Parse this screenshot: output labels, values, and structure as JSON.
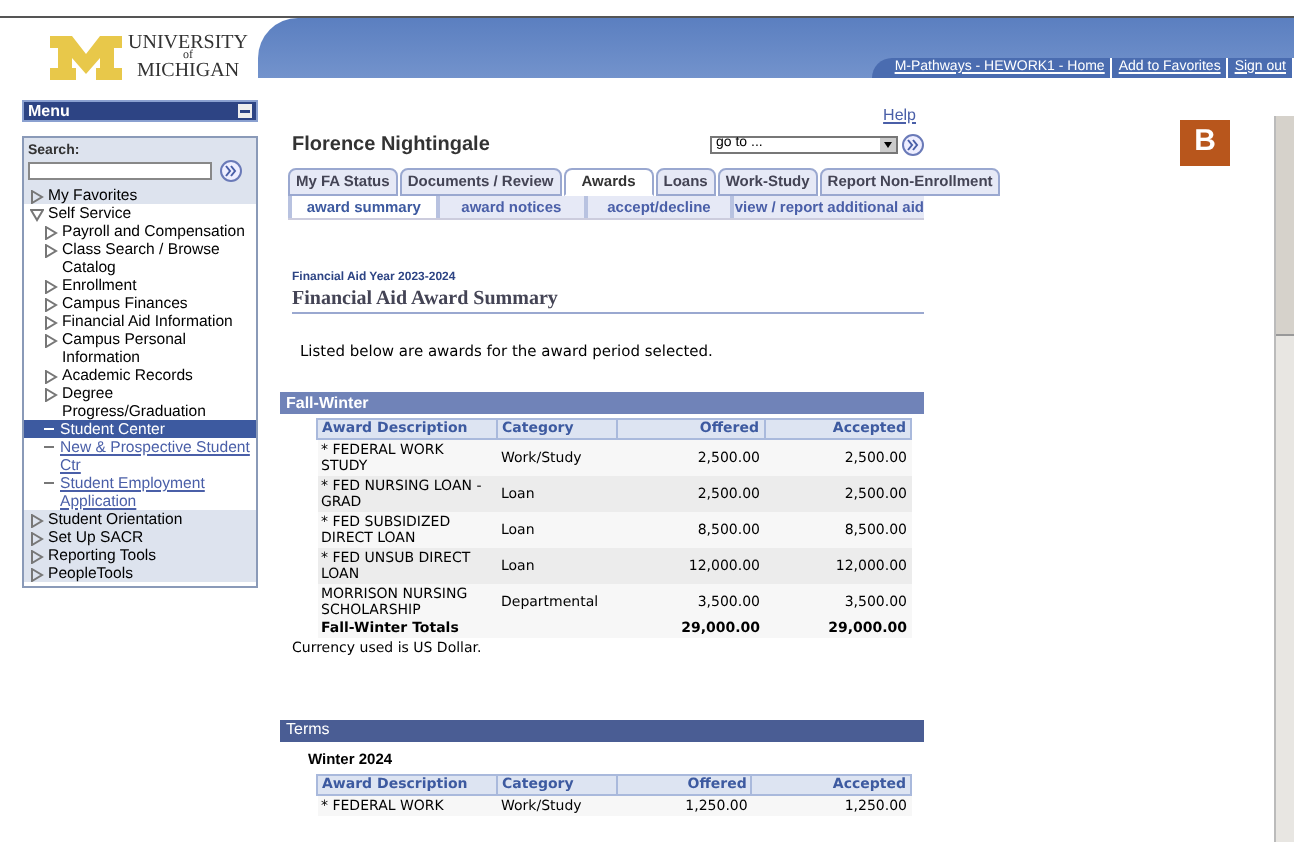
{
  "logo": {
    "line_1": "UNIVERSITY",
    "line_2": "of",
    "line_3": "MICHIGAN"
  },
  "header_links": [
    "M-Pathways - HEWORK1 - Home",
    "Add to Favorites",
    "Sign out"
  ],
  "menu": {
    "title": "Menu",
    "search_label": "Search:",
    "items": [
      {
        "label": "My Favorites",
        "kind": "folder",
        "expanded": false,
        "selected": false
      },
      {
        "label": "Self Service",
        "kind": "folder",
        "expanded": true,
        "selected": false,
        "children": [
          {
            "label": "Payroll and Compensation",
            "kind": "folder",
            "expanded": false,
            "selected": false
          },
          {
            "label": "Class Search / Browse Catalog",
            "kind": "folder",
            "expanded": false,
            "selected": false
          },
          {
            "label": "Enrollment",
            "kind": "folder",
            "expanded": false,
            "selected": false
          },
          {
            "label": "Campus Finances",
            "kind": "folder",
            "expanded": false,
            "selected": false
          },
          {
            "label": "Financial Aid Information",
            "kind": "folder",
            "expanded": false,
            "selected": false
          },
          {
            "label": "Campus Personal Information",
            "kind": "folder",
            "expanded": false,
            "selected": false
          },
          {
            "label": "Academic Records",
            "kind": "folder",
            "expanded": false,
            "selected": false
          },
          {
            "label": "Degree Progress/Graduation",
            "kind": "folder",
            "expanded": false,
            "selected": false
          },
          {
            "label": "Student Center",
            "kind": "link",
            "selected": true
          },
          {
            "label": "New & Prospective Student Ctr",
            "kind": "link",
            "selected": false
          },
          {
            "label": "Student Employment Application",
            "kind": "link",
            "selected": false
          }
        ]
      },
      {
        "label": "Student Orientation",
        "kind": "folder",
        "expanded": false,
        "selected": false
      },
      {
        "label": "Set Up SACR",
        "kind": "folder",
        "expanded": false,
        "selected": false
      },
      {
        "label": "Reporting Tools",
        "kind": "folder",
        "expanded": false,
        "selected": false
      },
      {
        "label": "PeopleTools",
        "kind": "folder",
        "expanded": false,
        "selected": false
      }
    ]
  },
  "help_link": "Help",
  "student_name": "Florence Nightingale",
  "goto": {
    "value": "go to ..."
  },
  "figure_label": "B",
  "tabs": [
    {
      "label": "My FA Status",
      "selected": false
    },
    {
      "label": "Documents / Review",
      "selected": false
    },
    {
      "label": "Awards",
      "selected": true
    },
    {
      "label": "Loans",
      "selected": false
    },
    {
      "label": "Work-Study",
      "selected": false
    },
    {
      "label": "Report Non-Enrollment",
      "selected": false
    }
  ],
  "subtabs": [
    {
      "label": "award summary",
      "selected": true
    },
    {
      "label": "award notices",
      "selected": false
    },
    {
      "label": "accept/decline",
      "selected": false
    },
    {
      "label": "view / report additional aid",
      "selected": false
    }
  ],
  "aid_year": "Financial Aid Year 2023-2024",
  "page_title": "Financial Aid Award Summary",
  "intro": "Listed below are awards for the award period selected.",
  "fall_winter": {
    "title": "Fall-Winter",
    "columns": [
      "Award Description",
      "Category",
      "Offered",
      "Accepted"
    ],
    "rows": [
      [
        "* FEDERAL WORK STUDY",
        "Work/Study",
        "2,500.00",
        "2,500.00"
      ],
      [
        "* FED NURSING LOAN - GRAD",
        "Loan",
        "2,500.00",
        "2,500.00"
      ],
      [
        "* FED SUBSIDIZED DIRECT LOAN",
        "Loan",
        "8,500.00",
        "8,500.00"
      ],
      [
        "* FED UNSUB DIRECT LOAN",
        "Loan",
        "12,000.00",
        "12,000.00"
      ],
      [
        "MORRISON NURSING SCHOLARSHIP",
        "Departmental",
        "3,500.00",
        "3,500.00"
      ]
    ],
    "totals": {
      "label": "Fall-Winter Totals",
      "offered": "29,000.00",
      "accepted": "29,000.00"
    },
    "note": "Currency used is US Dollar."
  },
  "terms": {
    "title": "Terms",
    "term": "Winter 2024",
    "columns": [
      "Award Description",
      "Category",
      "Offered",
      "Accepted"
    ],
    "rows": [
      [
        "* FEDERAL WORK",
        "Work/Study",
        "1,250.00",
        "1,250.00"
      ]
    ]
  }
}
